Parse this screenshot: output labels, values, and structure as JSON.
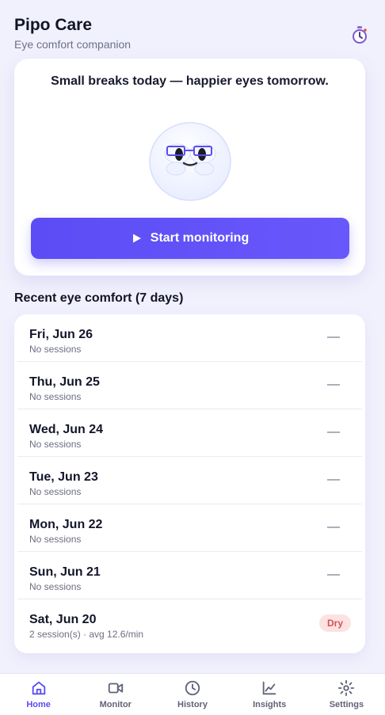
{
  "header": {
    "title": "Pipo Care",
    "subtitle": "Eye comfort companion",
    "timer_icon": "stopwatch-icon"
  },
  "hero": {
    "tagline": "Small breaks today — happier eyes tomorrow.",
    "button_label": "Start monitoring",
    "mascot_icon": "mascot-illustration"
  },
  "recent": {
    "title": "Recent eye comfort (7 days)",
    "rows": [
      {
        "date": "Fri, Jun 26",
        "summary": "No sessions",
        "status": "—"
      },
      {
        "date": "Thu, Jun 25",
        "summary": "No sessions",
        "status": "—"
      },
      {
        "date": "Wed, Jun 24",
        "summary": "No sessions",
        "status": "—"
      },
      {
        "date": "Tue, Jun 23",
        "summary": "No sessions",
        "status": "—"
      },
      {
        "date": "Mon, Jun 22",
        "summary": "No sessions",
        "status": "—"
      },
      {
        "date": "Sun, Jun 21",
        "summary": "No sessions",
        "status": "—"
      },
      {
        "date": "Sat, Jun 20",
        "summary": "2 session(s) · avg 12.6/min",
        "status": "Dry"
      }
    ]
  },
  "nav": {
    "items": [
      {
        "label": "Home",
        "icon": "home-icon",
        "active": true
      },
      {
        "label": "Monitor",
        "icon": "video-camera-icon",
        "active": false
      },
      {
        "label": "History",
        "icon": "clock-icon",
        "active": false
      },
      {
        "label": "Insights",
        "icon": "line-chart-icon",
        "active": false
      },
      {
        "label": "Settings",
        "icon": "gear-icon",
        "active": false
      }
    ]
  },
  "colors": {
    "accent": "#5a4df1",
    "background": "#f1f1fd",
    "dry_badge_bg": "#fde2e2",
    "dry_badge_text": "#d25454"
  }
}
